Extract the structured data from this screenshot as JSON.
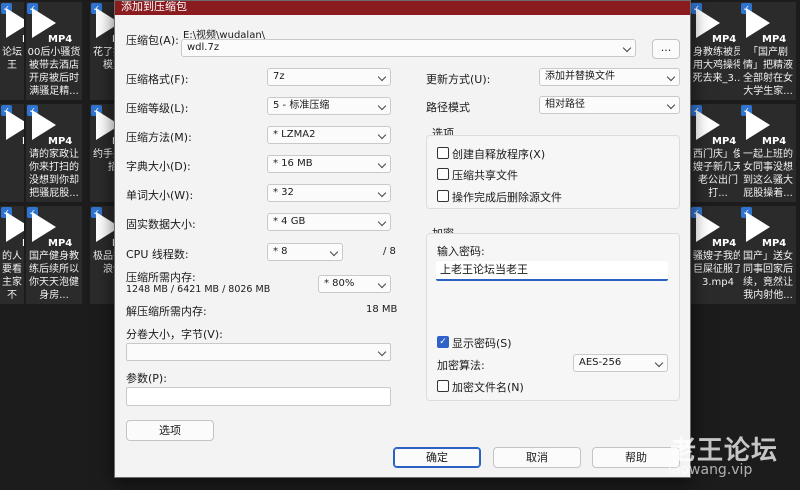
{
  "background": {
    "tiles_left": [
      {
        "label": "论坛\n王",
        "selected": false
      },
      {
        "label": "00后小骚货被带去酒店开房被后时满骚足精...",
        "selected": false
      },
      {
        "label": "花了找的职模太过",
        "selected": false
      },
      {
        "label": "",
        "selected": false
      },
      {
        "label": "请的家政让你来打扫的没想到你却把骚屁股...",
        "selected": false
      },
      {
        "label": "约手头室操招的",
        "selected": false
      },
      {
        "label": "的人要看主家不",
        "selected": false
      },
      {
        "label": "国产健身教练后续所以你天天泡健身房...",
        "selected": false
      },
      {
        "label": "极品替被发浪饭没",
        "selected": false
      }
    ],
    "tiles_right": [
      {
        "label": "身教练被员用大鸡操得死去来_3...",
        "selected": false
      },
      {
        "label": "「国产剧情」把精液全部射在女大学生家...",
        "selected": false
      },
      {
        "label": "西门庆」俊嫂子新几天老公出门打...",
        "selected": false
      },
      {
        "label": "一起上班的女同事没想到这么骚大屁股操着...",
        "selected": false
      },
      {
        "label": "骚嫂子我的巨屎征服了3.mp4",
        "selected": false
      },
      {
        "label": "国产」送女同事回家后续，竟然让我内射他...",
        "selected": false
      }
    ],
    "tile_badge": "MP4",
    "check_mark": "✓"
  },
  "dialog": {
    "title": "添加到压缩包",
    "archive_label": "压缩包(A):",
    "archive_path": "E:\\视频\\wudalan\\",
    "archive_name": "wdl.7z",
    "browse_label": "...",
    "format_label": "压缩格式(F):",
    "format_value": "7z",
    "level_label": "压缩等级(L):",
    "level_value": "5 - 标准压缩",
    "method_label": "压缩方法(M):",
    "method_value": "* LZMA2",
    "dict_label": "字典大小(D):",
    "dict_value": "* 16 MB",
    "word_label": "单词大小(W):",
    "word_value": "* 32",
    "solid_label": "固实数据大小:",
    "solid_value": "* 4 GB",
    "threads_label": "CPU 线程数:",
    "threads_value": "* 8",
    "threads_max": "/ 8",
    "mem_label": "压缩所需内存:",
    "mem_value": "1248 MB / 6421 MB / 8026 MB",
    "mem_percent": "* 80%",
    "decomp_label": "解压缩所需内存:",
    "decomp_value": "18 MB",
    "volume_label": "分卷大小，字节(V):",
    "volume_value": "",
    "params_label": "参数(P):",
    "params_value": "",
    "options_button": "选项",
    "update_label": "更新方式(U):",
    "update_value": "添加并替换文件",
    "path_label": "路径模式",
    "path_value": "相对路径",
    "options_group": "选项",
    "opt_sfx": "创建自释放程序(X)",
    "opt_shared": "压缩共享文件",
    "opt_delete": "操作完成后删除源文件",
    "encrypt_group": "加密",
    "password_label": "输入密码:",
    "password_value": "上老王论坛当老王",
    "show_password": "显示密码(S)",
    "algo_label": "加密算法:",
    "algo_value": "AES-256",
    "encrypt_names": "加密文件名(N)",
    "ok_button": "确定",
    "cancel_button": "取消",
    "help_button": "帮助"
  },
  "watermark": {
    "line1": "老王论坛",
    "line2": "laowang.vip"
  }
}
